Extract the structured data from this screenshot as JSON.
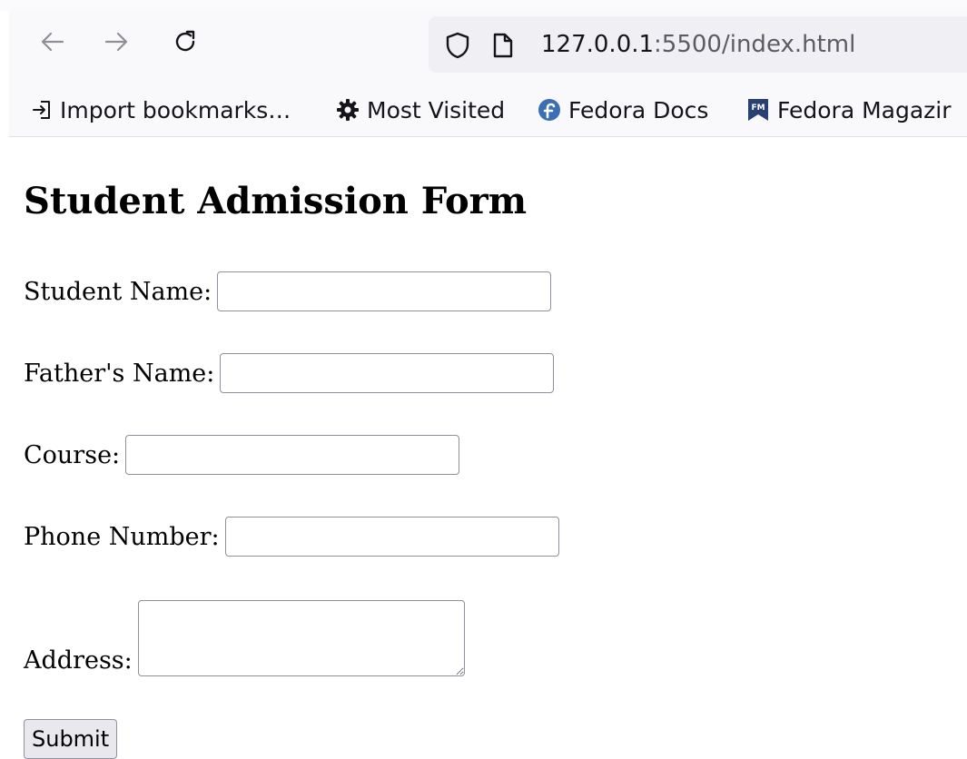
{
  "browser": {
    "nav": {
      "back_icon": "arrow-left-icon",
      "forward_icon": "arrow-right-icon",
      "reload_icon": "reload-icon"
    },
    "url": {
      "host": "127.0.0.1",
      "rest": ":5500/index.html"
    },
    "bookmarks": [
      {
        "label": "Import bookmarks…",
        "icon": "import-icon"
      },
      {
        "label": "Most Visited",
        "icon": "gear-icon"
      },
      {
        "label": "Fedora Docs",
        "icon": "fedora-icon"
      },
      {
        "label": "Fedora Magazir",
        "icon": "fedora-magazine-icon"
      }
    ]
  },
  "form": {
    "title": "Student Admission Form",
    "fields": {
      "student_name": {
        "label": "Student Name:",
        "value": ""
      },
      "fathers_name": {
        "label": "Father's Name:",
        "value": ""
      },
      "course": {
        "label": "Course:",
        "value": ""
      },
      "phone": {
        "label": "Phone Number:",
        "value": ""
      },
      "address": {
        "label": "Address:",
        "value": ""
      }
    },
    "submit_label": "Submit"
  },
  "colors": {
    "toolbar_bg": "#f9f9fb",
    "urlbar_bg": "#f0f0f4",
    "field_border": "#8f8f9d",
    "button_bg": "#e9e9ed"
  }
}
